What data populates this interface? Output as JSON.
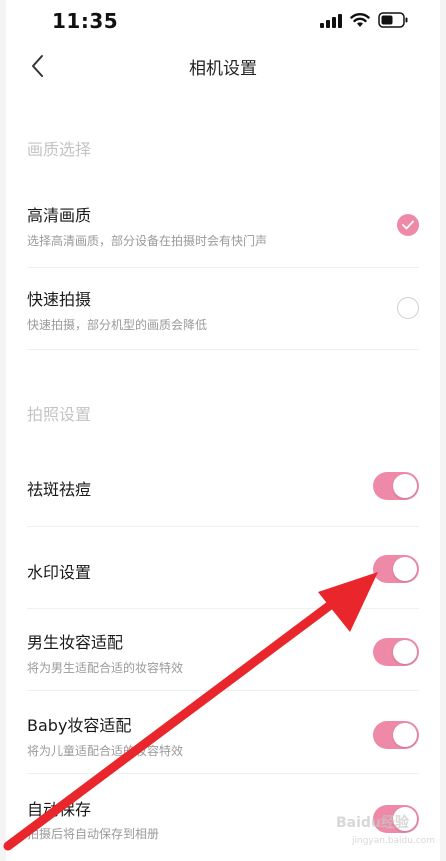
{
  "status_bar": {
    "time": "11:35"
  },
  "nav": {
    "title": "相机设置"
  },
  "sections": {
    "quality": {
      "header": "画质选择",
      "items": [
        {
          "title": "高清画质",
          "desc": "选择高清画质，部分设备在拍摄时会有快门声",
          "selected": true
        },
        {
          "title": "快速拍摄",
          "desc": "快速拍摄，部分机型的画质会降低",
          "selected": false
        }
      ]
    },
    "photo": {
      "header": "拍照设置",
      "items": [
        {
          "title": "祛斑祛痘",
          "desc": "",
          "on": true
        },
        {
          "title": "水印设置",
          "desc": "",
          "on": true
        },
        {
          "title": "男生妆容适配",
          "desc": "将为男生适配合适的妆容特效",
          "on": true
        },
        {
          "title": "Baby妆容适配",
          "desc": "将为儿童适配合适的妆容特效",
          "on": true
        },
        {
          "title": "自动保存",
          "desc": "拍摄后将自动保存到相册",
          "on": true
        }
      ]
    }
  },
  "watermark": {
    "text": "Baidu经验",
    "sub": "jingyan.baidu.com"
  },
  "colors": {
    "accent": "#ee8aa8",
    "annotation_arrow": "#e8262b"
  }
}
